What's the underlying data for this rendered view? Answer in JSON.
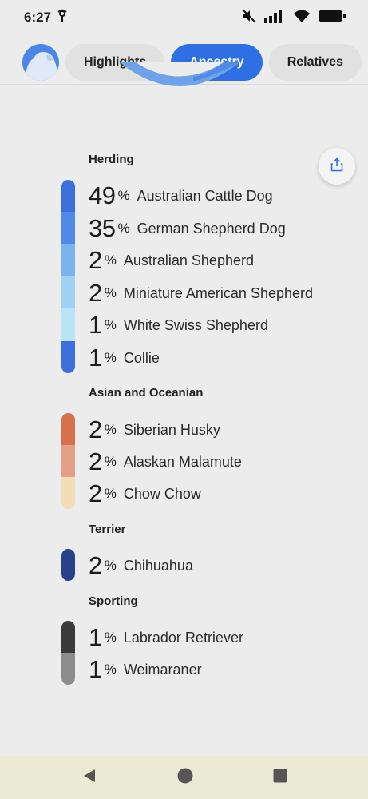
{
  "status": {
    "time": "6:27"
  },
  "tabs": [
    {
      "label": "Highlights"
    },
    {
      "label": "Ancestry"
    },
    {
      "label": "Relatives"
    }
  ],
  "groups": [
    {
      "title": "Herding",
      "breeds": [
        {
          "pct": "49",
          "name": "Australian Cattle Dog"
        },
        {
          "pct": "35",
          "name": "German Shepherd Dog"
        },
        {
          "pct": "2",
          "name": "Australian Shepherd"
        },
        {
          "pct": "2",
          "name": "Miniature American Shepherd"
        },
        {
          "pct": "1",
          "name": "White Swiss Shepherd"
        },
        {
          "pct": "1",
          "name": "Collie"
        }
      ]
    },
    {
      "title": "Asian and Oceanian",
      "breeds": [
        {
          "pct": "2",
          "name": "Siberian Husky"
        },
        {
          "pct": "2",
          "name": "Alaskan Malamute"
        },
        {
          "pct": "2",
          "name": "Chow Chow"
        }
      ]
    },
    {
      "title": "Terrier",
      "breeds": [
        {
          "pct": "2",
          "name": "Chihuahua"
        }
      ]
    },
    {
      "title": "Sporting",
      "breeds": [
        {
          "pct": "1",
          "name": "Labrador Retriever"
        },
        {
          "pct": "1",
          "name": "Weimaraner"
        }
      ]
    }
  ],
  "percent_sign": "%",
  "colors": {
    "accent": "#2f6fe4",
    "herding": [
      "#3d6fdc",
      "#4f8be6",
      "#79b4ee",
      "#9dd2f2",
      "#b8e4f6",
      "#c6ecf8"
    ],
    "asian": [
      "#d9704c",
      "#e3a086",
      "#f1ddb8"
    ],
    "terrier": [
      "#27418a",
      "#3b5fb2"
    ],
    "sporting": [
      "#3a3a3a",
      "#8d8d8d"
    ]
  }
}
